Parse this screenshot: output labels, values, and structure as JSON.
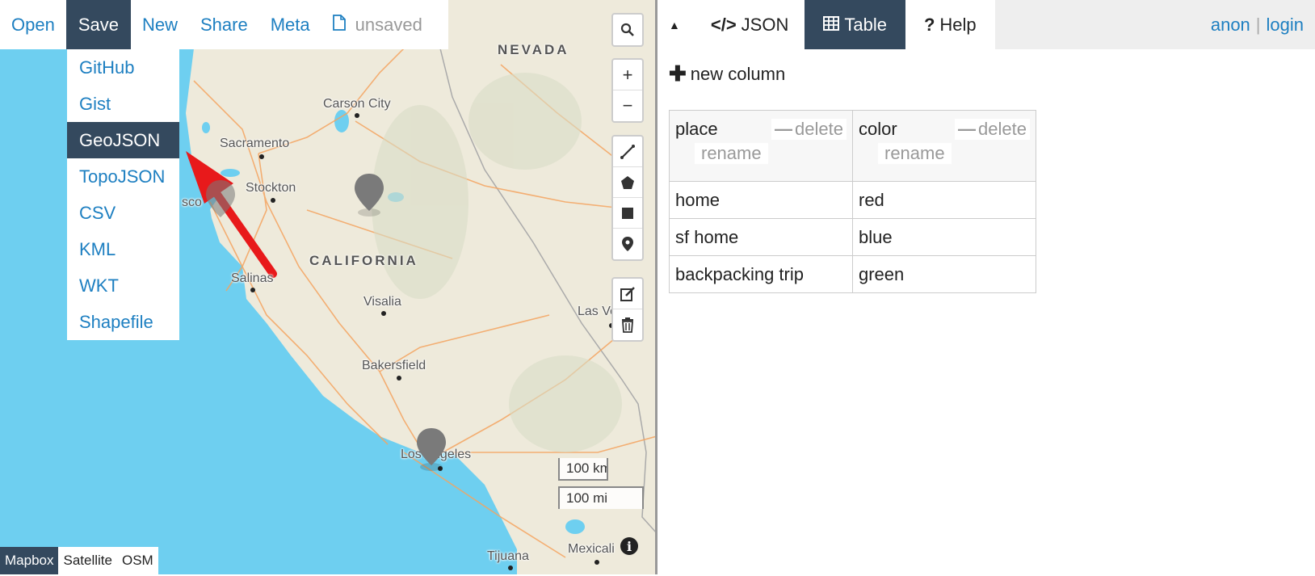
{
  "topbar": {
    "items": [
      "Open",
      "Save",
      "New",
      "Share",
      "Meta"
    ],
    "status": "unsaved",
    "status_icon": "document-icon"
  },
  "save_menu": {
    "items": [
      "GitHub",
      "Gist",
      "GeoJSON",
      "TopoJSON",
      "CSV",
      "KML",
      "WKT",
      "Shapefile"
    ],
    "highlighted": "GeoJSON"
  },
  "map": {
    "state_labels": [
      "NEVADA",
      "CALIFORNIA"
    ],
    "city_labels": [
      "Carson City",
      "Sacramento",
      "Stockton",
      "Salinas",
      "Visalia",
      "Bakersfield",
      "Los Angeles",
      "Las Vegas",
      "Tijuana",
      "Mexicali",
      "sco"
    ],
    "scale_km": "100 km",
    "scale_mi": "100 mi",
    "layers": [
      "Mapbox",
      "Satellite",
      "OSM"
    ],
    "active_layer": "Mapbox",
    "colors": {
      "land": "#eeeadb",
      "water": "#6ecff0",
      "roads": "#f4a460",
      "marker": "#7a7a7a",
      "arrow": "#e8191b"
    },
    "controls": {
      "search": "search-icon",
      "zoom_in": "+",
      "zoom_out": "−",
      "draw": [
        "line-icon",
        "polygon-icon",
        "rectangle-icon",
        "marker-icon"
      ],
      "edit": [
        "edit-icon",
        "trash-icon"
      ]
    }
  },
  "right_pane": {
    "collapse_icon": "caret-up-icon",
    "tabs": [
      {
        "label": "JSON",
        "icon": "code-icon"
      },
      {
        "label": "Table",
        "icon": "table-icon"
      },
      {
        "label": "Help",
        "icon": "question-icon"
      }
    ],
    "active_tab": "Table",
    "auth": {
      "anon": "anon",
      "separator": "|",
      "login": "login"
    },
    "new_column": "new column"
  },
  "table": {
    "columns": [
      {
        "name": "place",
        "delete": "delete",
        "rename": "rename"
      },
      {
        "name": "color",
        "delete": "delete",
        "rename": "rename"
      }
    ],
    "rows": [
      [
        "home",
        "red"
      ],
      [
        "sf home",
        "blue"
      ],
      [
        "backpacking trip",
        "green"
      ]
    ]
  }
}
